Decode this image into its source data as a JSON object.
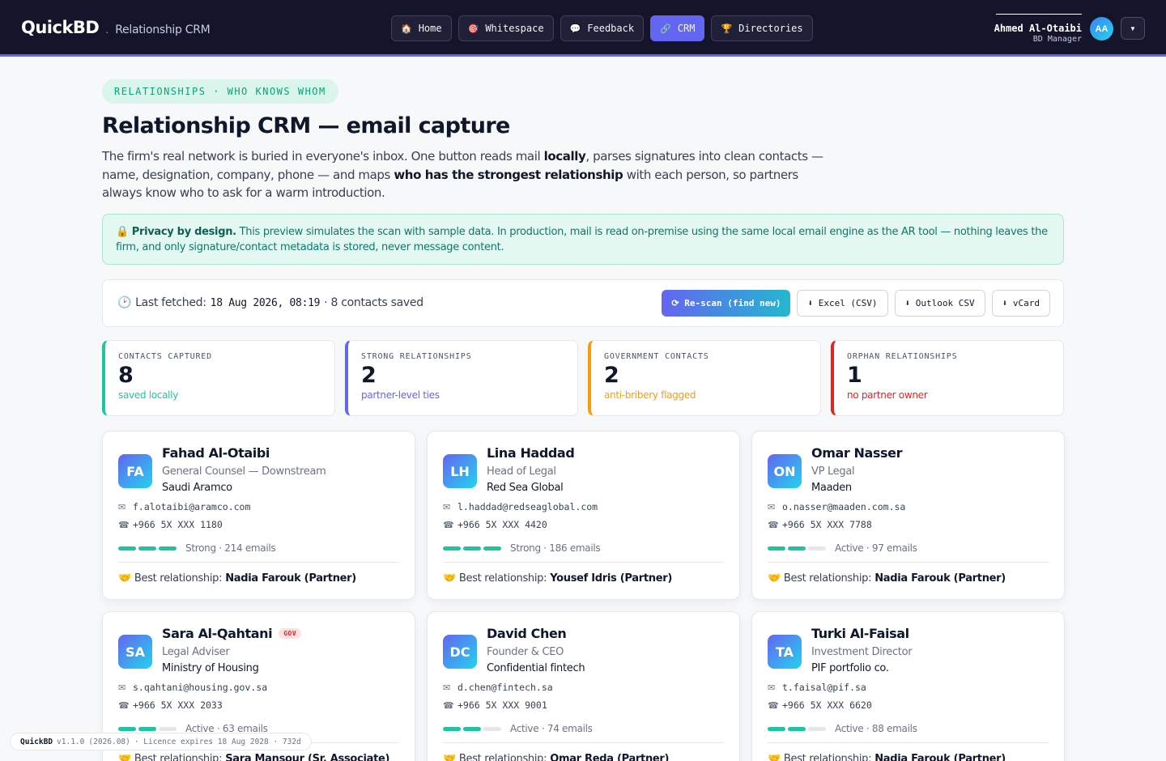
{
  "brand": {
    "name": "QuickBD",
    "separator": ".",
    "subtitle": "Relationship CRM"
  },
  "nav": [
    {
      "label": "Home",
      "icon": "🏠"
    },
    {
      "label": "Whitespace",
      "icon": "🎯"
    },
    {
      "label": "Feedback",
      "icon": "💬"
    },
    {
      "label": "CRM",
      "icon": "🔗",
      "active": true
    },
    {
      "label": "Directories",
      "icon": "🏆"
    }
  ],
  "user": {
    "name": "Ahmed Al-Otaibi",
    "role": "BD Manager",
    "initials": "AA",
    "menu_icon": "▼"
  },
  "header": {
    "eyebrow": "RELATIONSHIPS · WHO KNOWS WHOM",
    "title": "Relationship CRM — email capture",
    "lede_parts": [
      "The firm's real network is buried in everyone's inbox. One button reads mail ",
      "locally",
      ", parses signatures into clean contacts — name, designation, company, phone — and maps ",
      "who has the strongest relationship",
      " with each person, so partners always know who to ask for a warm introduction."
    ]
  },
  "privacy": {
    "icon": "🔒",
    "title": "Privacy by design.",
    "text": " This preview simulates the scan with sample data. In production, mail is read on-premise using the same local email engine as the AR tool — nothing leaves the firm, and only signature/contact metadata is stored, never message content."
  },
  "fetch": {
    "icon": "🕑",
    "label": "Last fetched:",
    "date": "18 Aug 2026, 08:19",
    "saved": "· 8 contacts saved",
    "buttons": {
      "rescan": "⟳ Re-scan (find new)",
      "excel": "⬇ Excel (CSV)",
      "outlook": "⬇ Outlook CSV",
      "vcard": "⬇ vCard"
    }
  },
  "stats": [
    {
      "label": "CONTACTS CAPTURED",
      "value": "8",
      "note": "saved locally",
      "color": "#1fc4a0"
    },
    {
      "label": "STRONG RELATIONSHIPS",
      "value": "2",
      "note": "partner-level ties",
      "color": "#6366f1"
    },
    {
      "label": "GOVERNMENT CONTACTS",
      "value": "2",
      "note": "anti-bribery flagged",
      "color": "#f59e0b"
    },
    {
      "label": "ORPHAN RELATIONSHIPS",
      "value": "1",
      "note": "no partner owner",
      "color": "#dc2626"
    }
  ],
  "contacts": [
    {
      "initials": "FA",
      "name": "Fahad Al-Otaibi",
      "gov": "",
      "role": "General Counsel — Downstream",
      "company": "Saudi Aramco",
      "email": "f.alotaibi@aramco.com",
      "phone": "+966 5X XXX 1180",
      "strength": 3,
      "strength_label": "Strong · 214 emails",
      "best_label": "Best relationship:",
      "best": "Nadia Farouk (Partner)"
    },
    {
      "initials": "LH",
      "name": "Lina Haddad",
      "gov": "",
      "role": "Head of Legal",
      "company": "Red Sea Global",
      "email": "l.haddad@redseaglobal.com",
      "phone": "+966 5X XXX 4420",
      "strength": 3,
      "strength_label": "Strong · 186 emails",
      "best_label": "Best relationship:",
      "best": "Yousef Idris (Partner)"
    },
    {
      "initials": "ON",
      "name": "Omar Nasser",
      "gov": "",
      "role": "VP Legal",
      "company": "Maaden",
      "email": "o.nasser@maaden.com.sa",
      "phone": "+966 5X XXX 7788",
      "strength": 2,
      "strength_label": "Active · 97 emails",
      "best_label": "Best relationship:",
      "best": "Nadia Farouk (Partner)"
    },
    {
      "initials": "SA",
      "name": "Sara Al-Qahtani",
      "gov": "GOV",
      "role": "Legal Adviser",
      "company": "Ministry of Housing",
      "email": "s.qahtani@housing.gov.sa",
      "phone": "+966 5X XXX 2033",
      "strength": 2,
      "strength_label": "Active · 63 emails",
      "best_label": "Best relationship:",
      "best": "Sara Mansour (Sr. Associate)"
    },
    {
      "initials": "DC",
      "name": "David Chen",
      "gov": "",
      "role": "Founder & CEO",
      "company": "Confidential fintech",
      "email": "d.chen@fintech.sa",
      "phone": "+966 5X XXX 9001",
      "strength": 2,
      "strength_label": "Active · 74 emails",
      "best_label": "Best relationship:",
      "best": "Omar Reda (Partner)"
    },
    {
      "initials": "TA",
      "name": "Turki Al-Faisal",
      "gov": "",
      "role": "Investment Director",
      "company": "PIF portfolio co.",
      "email": "t.faisal@pif.sa",
      "phone": "+966 5X XXX 6620",
      "strength": 2,
      "strength_label": "Active · 88 emails",
      "best_label": "Best relationship:",
      "best": "Nadia Farouk (Partner)"
    }
  ],
  "icons": {
    "email": "✉",
    "phone": "☎",
    "best": "🤝"
  },
  "footer": {
    "app": "QuickBD",
    "version": "v1.1.0",
    "build": "(2026.08)",
    "licence": "· Licence expires 18 Aug 2028 · 732d"
  }
}
